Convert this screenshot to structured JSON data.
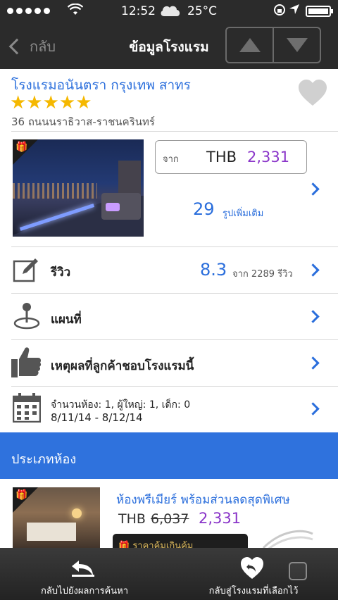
{
  "status_bar": {
    "time": "12:52",
    "temperature": "25°C",
    "signal_dots": 5
  },
  "nav": {
    "back_label": "กลับ",
    "title": "ข้อมูลโรงแรม"
  },
  "hotel": {
    "name": "โรงแรมอนันตรา กรุงเทพ สาทร",
    "star_rating": 5,
    "stars": "★★★★★",
    "address": "36 ถนนนราธิวาส-ราชนครินทร์",
    "favorite": false
  },
  "price": {
    "from_label": "จาก",
    "currency": "THB",
    "value": "2,331"
  },
  "photos": {
    "more_count": "29",
    "more_label": "รูปเพิ่มเติม"
  },
  "review": {
    "label": "รีวิว",
    "score": "8.3",
    "count_text": "จาก 2289 รีวิว"
  },
  "map": {
    "label": "แผนที่"
  },
  "reasons": {
    "label": "เหตุผลที่ลูกค้าชอบโรงแรมนี้"
  },
  "booking": {
    "line1": "จำนวนห้อง: 1, ผู้ใหญ่: 1, เด็ก: 0",
    "line2": "8/11/14 - 8/12/14"
  },
  "room_types": {
    "title": "ประเภทห้อง",
    "rooms": [
      {
        "name": "ห้องพรีเมียร์ พร้อมส่วนลดสุดพิเศษ",
        "currency": "THB",
        "old_price": "6,037",
        "new_price": "2,331",
        "promo": "ราคาคุ้มเกินคุ้ม"
      }
    ]
  },
  "tab_bar": {
    "back_to_results": "กลับไปยังผลการค้นหา",
    "back_to_selected": "กลับสู่โรงแรมที่เลือกไว้"
  },
  "colors": {
    "bar_dark": "#2b2b2b",
    "link_blue": "#2a6edc",
    "price_purple": "#8a35c9",
    "star_gold": "#f5b800",
    "section_blue": "#2f72dd"
  },
  "icons": [
    "apple-icon",
    "wifi-icon",
    "cloud-icon",
    "rotation-lock-icon",
    "location-icon",
    "battery-icon",
    "chevron-left-icon",
    "arrow-up-icon",
    "arrow-down-icon",
    "heart-icon",
    "gift-icon",
    "chevron-right-icon",
    "edit-icon",
    "map-pin-icon",
    "thumbs-up-icon",
    "calendar-icon",
    "return-icon",
    "heart-return-icon"
  ]
}
